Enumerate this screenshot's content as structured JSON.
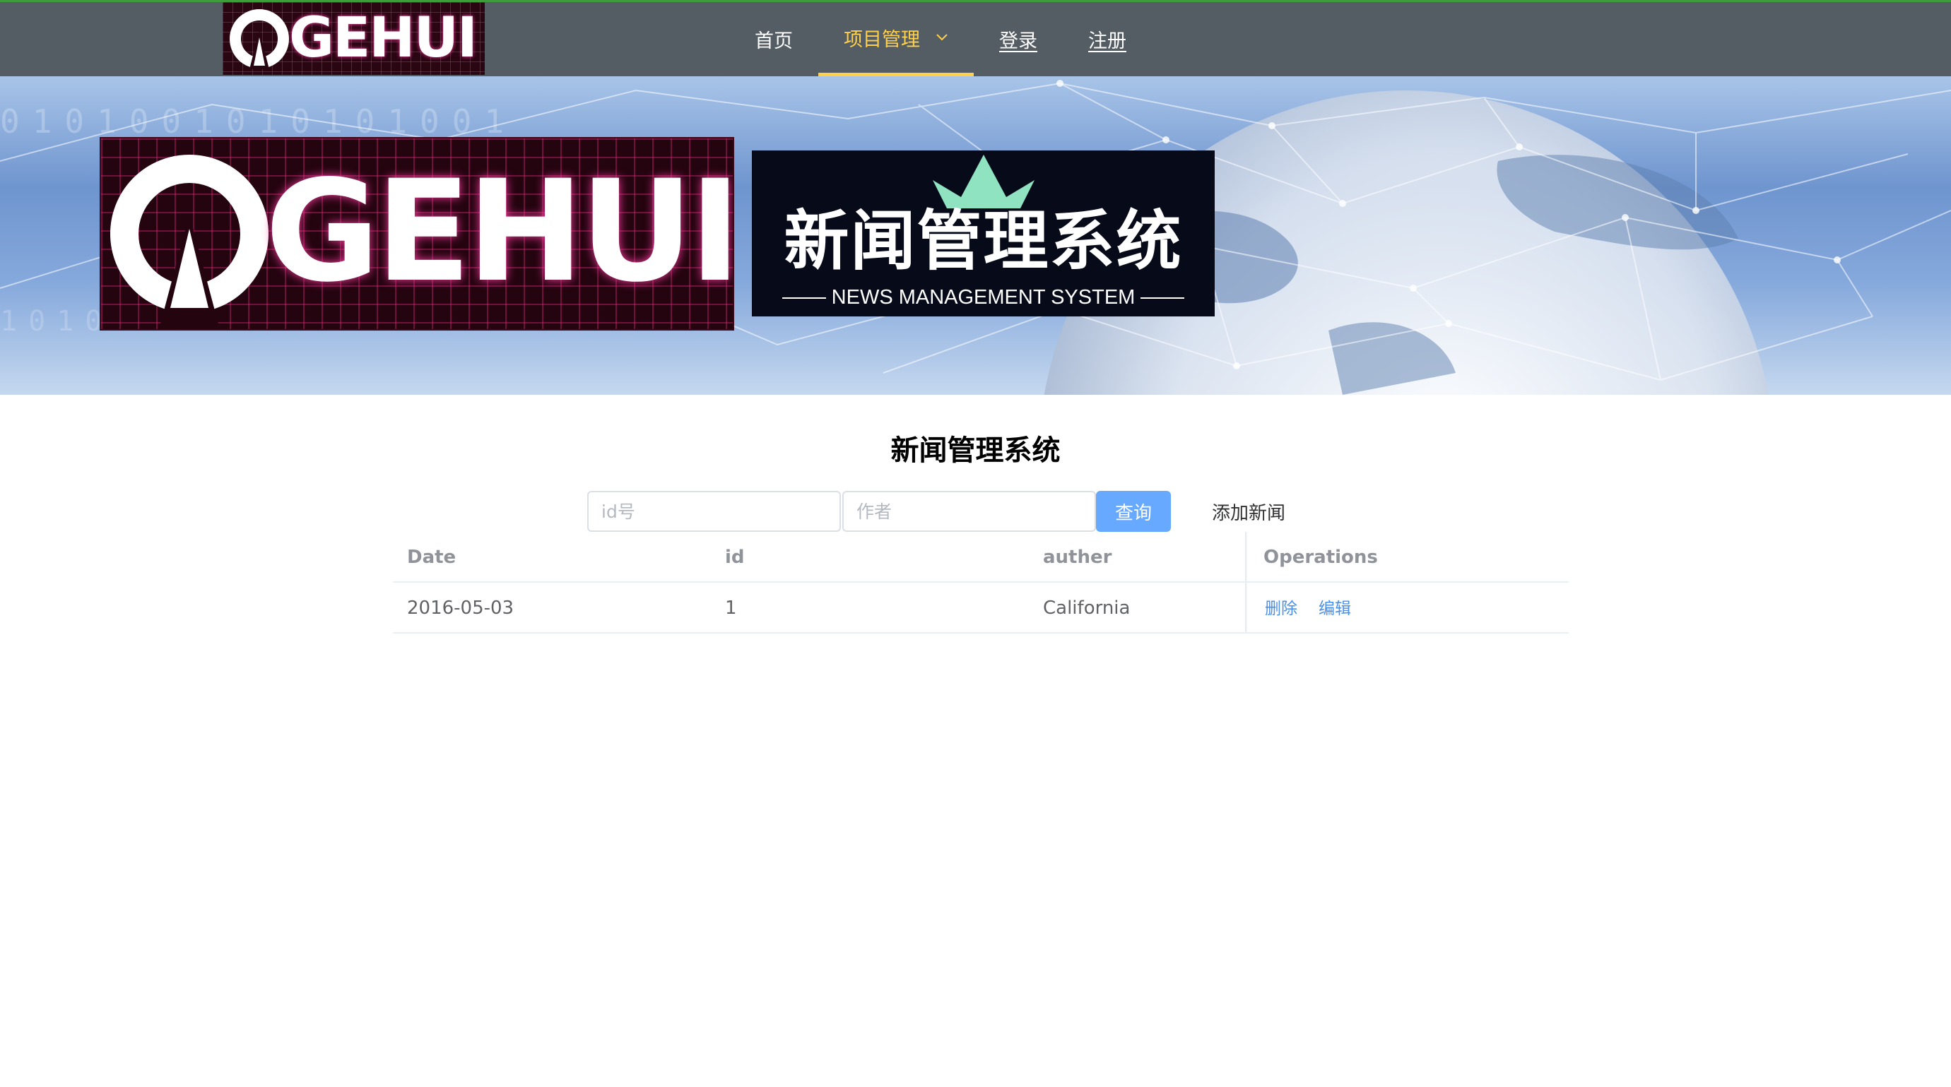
{
  "nav": {
    "logo_text": "GEHUI",
    "items": [
      {
        "label": "首页"
      },
      {
        "label": "项目管理"
      },
      {
        "label": "登录"
      },
      {
        "label": "注册"
      }
    ],
    "active_color": "#ffd04b",
    "background": "#545c64"
  },
  "banner": {
    "logo_text": "GEHUI",
    "title_cn": "新闻管理系统",
    "title_en": "NEWS MANAGEMENT SYSTEM"
  },
  "main": {
    "title": "新闻管理系统",
    "search": {
      "id_placeholder": "id号",
      "author_placeholder": "作者",
      "query_label": "查询",
      "add_label": "添加新闻"
    },
    "table": {
      "columns": [
        "Date",
        "id",
        "auther",
        "Operations"
      ],
      "rows": [
        {
          "date": "2016-05-03",
          "id": "1",
          "auther": "California",
          "ops": [
            "删除",
            "编辑"
          ]
        }
      ]
    }
  },
  "colors": {
    "primary": "#66a9ff",
    "link": "#4a8fe8"
  }
}
